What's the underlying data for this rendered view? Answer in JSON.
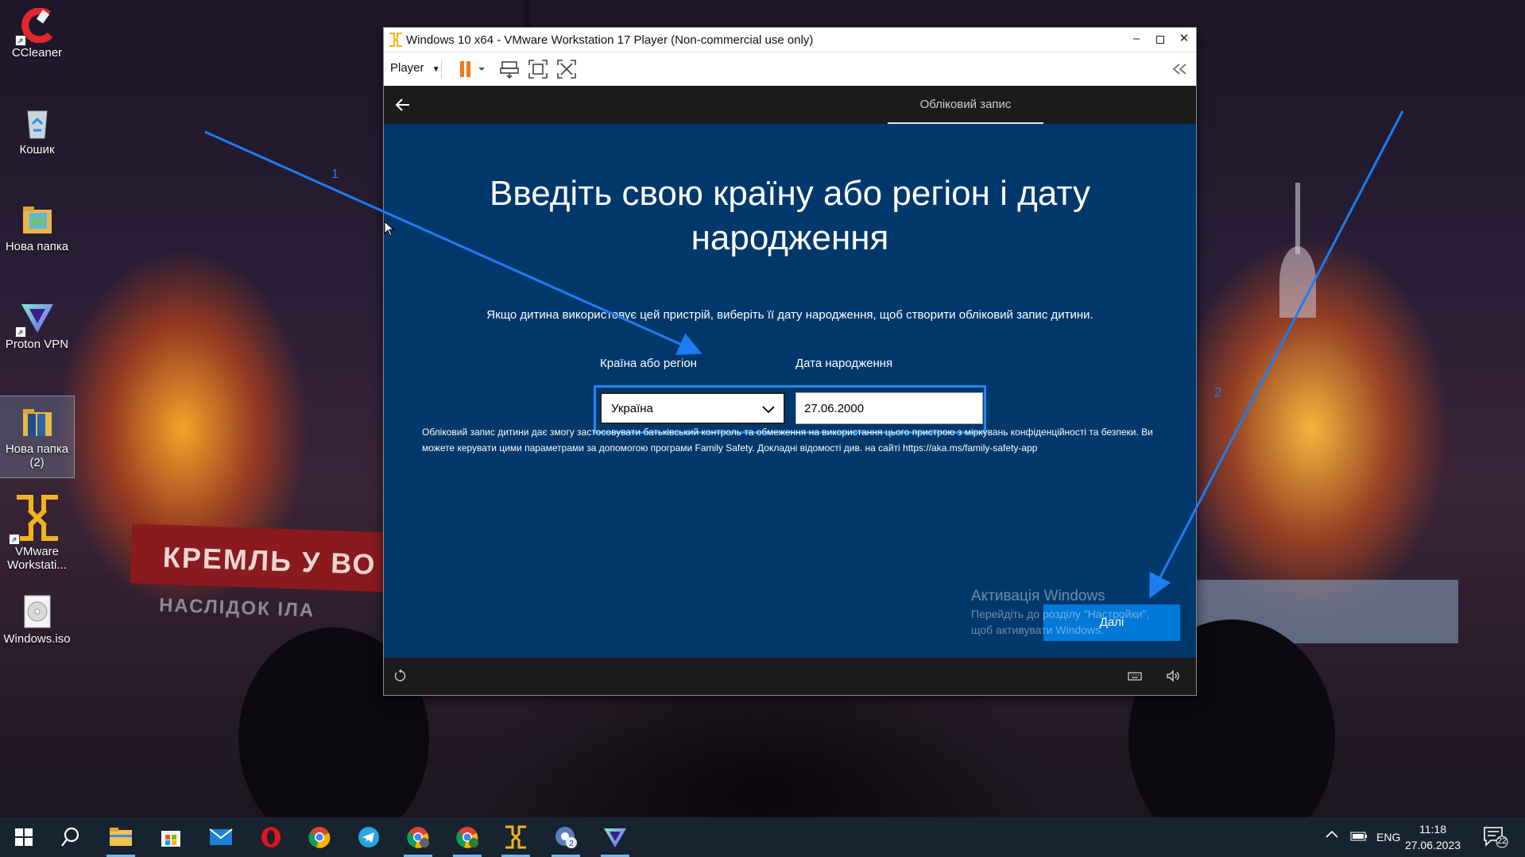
{
  "desktop": {
    "icons": [
      {
        "label": "CCleaner",
        "icon": "ccleaner-icon"
      },
      {
        "label": "Кошик",
        "icon": "recycle-bin-icon"
      },
      {
        "label": "Нова папка",
        "icon": "folder-icon"
      },
      {
        "label": "Proton VPN",
        "icon": "proton-vpn-icon"
      },
      {
        "label": "Нова папка (2)",
        "icon": "folder-icon"
      },
      {
        "label": "VMware Workstati...",
        "icon": "vmware-icon"
      },
      {
        "label": "Windows.iso",
        "icon": "disc-image-icon"
      }
    ],
    "wallpaper": {
      "banner_text": "КРЕМЛЬ У ВО",
      "banner_subtext": "НАСЛІДОК ІЛА"
    }
  },
  "vm_window": {
    "title": "Windows 10 x64 - VMware Workstation 17 Player (Non-commercial use only)",
    "menu": {
      "player_label": "Player"
    },
    "accent_color": "#f07a1a"
  },
  "oobe": {
    "tab_label": "Обліковий запис",
    "headline_line1": "Введіть свою країну або регіон і дату",
    "headline_line2": "народження",
    "subtext": "Якщо дитина використовує цей пристрій, виберіть її дату народження, щоб створити обліковий запис дитини.",
    "country_label": "Країна або регіон",
    "country_value": "Україна",
    "birthdate_label": "Дата народження",
    "birthdate_value": "27.06.2000",
    "info_text": "Обліковий запис дитини дає змогу застосовувати батьківський контроль та обмеження на використання цього пристрою з міркувань конфіденційності та безпеки. Ви можете керувати цими параметрами за допомогою програми Family Safety. Докладні відомості див. на сайті https://aka.ms/family-safety-app",
    "next_label": "Далі",
    "background_color": "#00386b",
    "button_color": "#0078d7"
  },
  "activation": {
    "title": "Активація Windows",
    "line1": "Перейдіть до розділу \"Настройки\",",
    "line2": "щоб активувати Windows."
  },
  "annotations": {
    "arrow1_label": "1",
    "arrow2_label": "2",
    "color": "#1d7df0"
  },
  "taskbar": {
    "apps": [
      "start-icon",
      "search-icon",
      "file-explorer-icon",
      "microsoft-store-icon",
      "mail-icon",
      "opera-icon",
      "chrome-icon",
      "telegram-icon",
      "chrome-profile-c-icon",
      "chrome-profile-j-icon",
      "vmware-icon",
      "chrome-profile-2-icon",
      "proton-vpn-icon"
    ],
    "language": "ENG",
    "time": "11:18",
    "date": "27.06.2023",
    "notification_count": "22"
  }
}
